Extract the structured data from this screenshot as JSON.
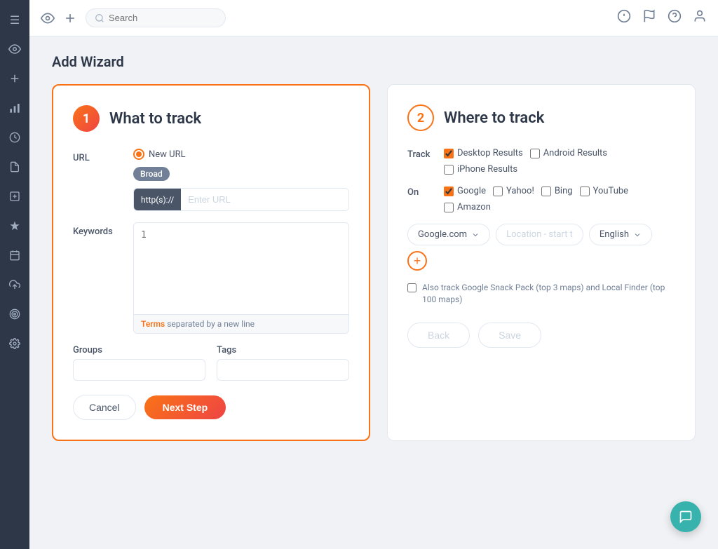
{
  "sidebar": {
    "icons": [
      {
        "name": "menu-icon",
        "symbol": "☰"
      },
      {
        "name": "eye-icon",
        "symbol": "👁"
      },
      {
        "name": "plus-icon",
        "symbol": "+"
      },
      {
        "name": "chart-icon",
        "symbol": "📊"
      },
      {
        "name": "clock-icon",
        "symbol": "🕐"
      },
      {
        "name": "file-icon",
        "symbol": "📄"
      },
      {
        "name": "add-box-icon",
        "symbol": "⊞"
      },
      {
        "name": "star-icon",
        "symbol": "✦"
      },
      {
        "name": "calendar-icon",
        "symbol": "📅"
      },
      {
        "name": "upload-icon",
        "symbol": "⬆"
      },
      {
        "name": "target-icon",
        "symbol": "🎯"
      },
      {
        "name": "settings-icon",
        "symbol": "⚙"
      }
    ]
  },
  "topbar": {
    "search_placeholder": "Search",
    "notification_count": "0"
  },
  "page": {
    "title": "Add Wizard"
  },
  "step1": {
    "number": "1",
    "title": "What to track",
    "url_label": "URL",
    "radio_label": "New URL",
    "toggle_label": "Broad",
    "url_prefix": "http(s)://",
    "url_placeholder": "Enter URL",
    "keywords_label": "Keywords",
    "keywords_placeholder": "1",
    "terms_text": "Terms",
    "terms_suffix": "separated by a new line",
    "groups_label": "Groups",
    "tags_label": "Tags",
    "cancel_label": "Cancel",
    "next_label": "Next Step"
  },
  "step2": {
    "number": "2",
    "title": "Where to track",
    "track_label": "Track",
    "checkboxes_track": [
      {
        "label": "Desktop Results",
        "checked": true
      },
      {
        "label": "Android Results",
        "checked": false
      },
      {
        "label": "iPhone Results",
        "checked": false
      }
    ],
    "on_label": "On",
    "checkboxes_on": [
      {
        "label": "Google",
        "checked": true
      },
      {
        "label": "Yahoo!",
        "checked": false
      },
      {
        "label": "Bing",
        "checked": false
      },
      {
        "label": "YouTube",
        "checked": false
      },
      {
        "label": "Amazon",
        "checked": false
      }
    ],
    "google_option": "Google.com",
    "location_placeholder": "Location - start t",
    "language_option": "English",
    "snack_text": "Also track Google Snack Pack (top 3 maps) and Local Finder (top 100 maps)",
    "back_label": "Back",
    "save_label": "Save"
  }
}
